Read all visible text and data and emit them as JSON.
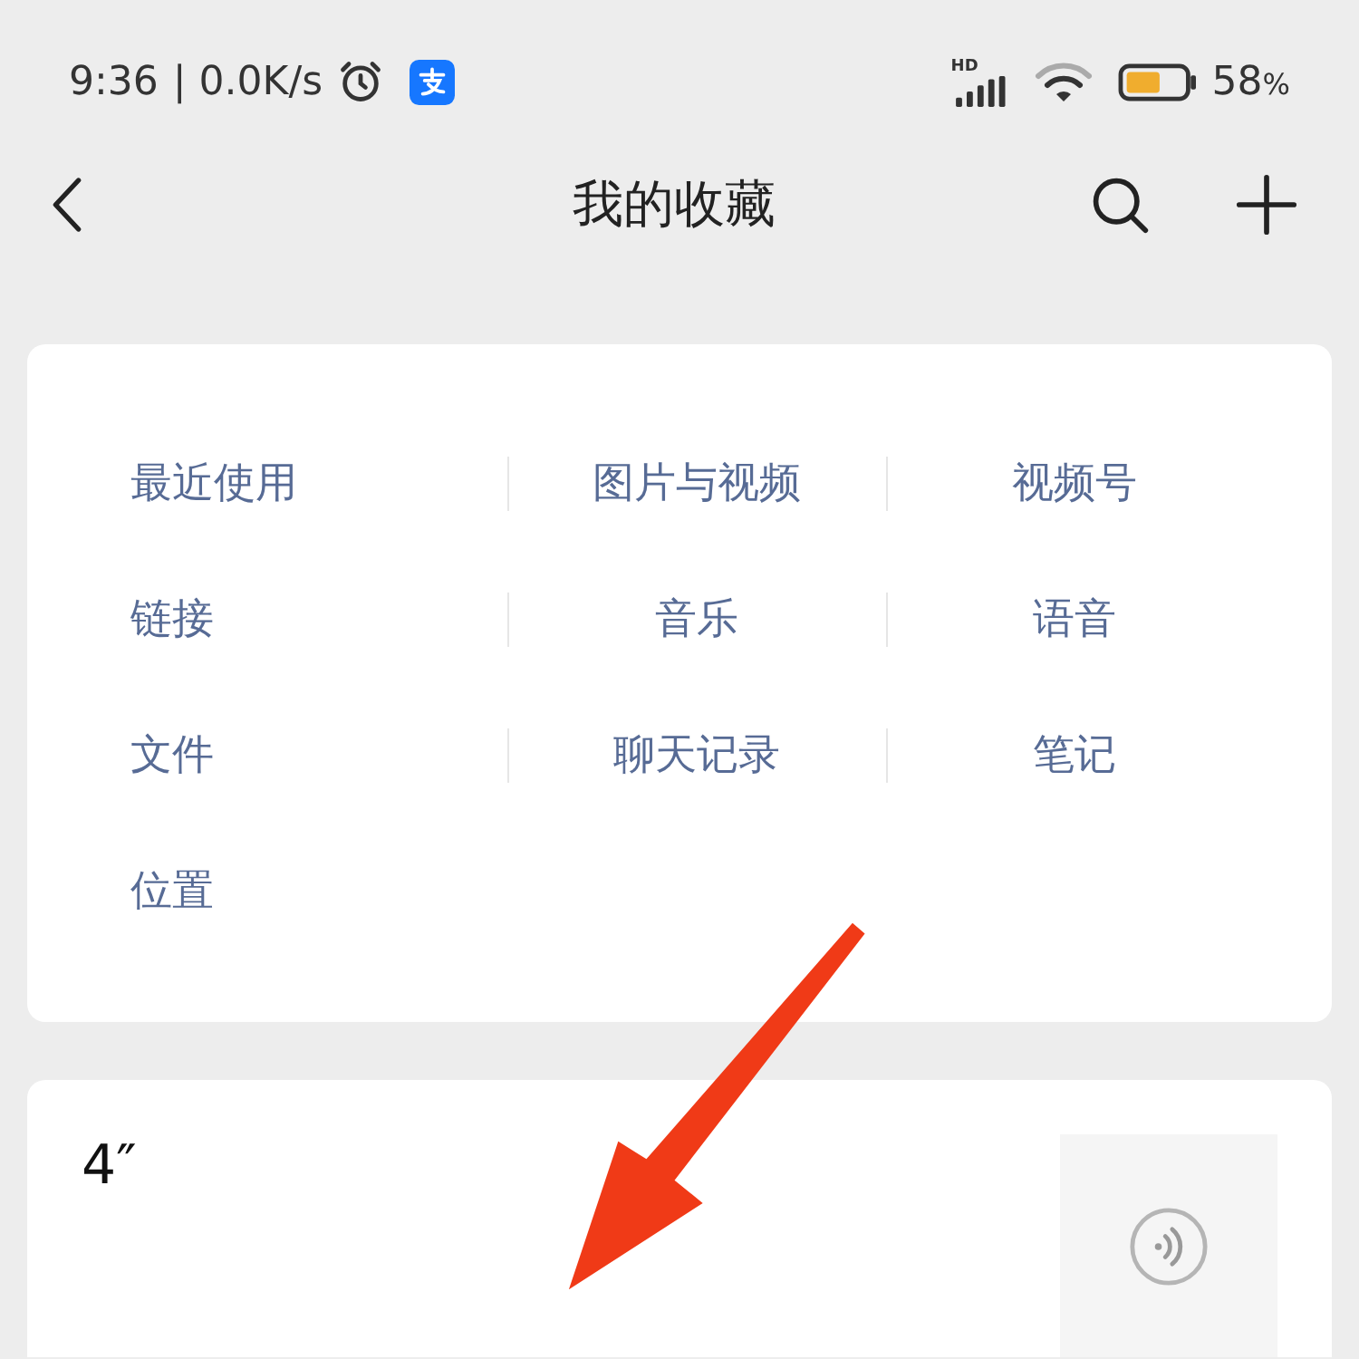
{
  "status_bar": {
    "time": "9:36",
    "speed": "| 0.0K/s",
    "network_label": "HD",
    "battery": "58",
    "battery_unit": "%"
  },
  "header": {
    "title": "我的收藏"
  },
  "categories": [
    {
      "label": "最近使用"
    },
    {
      "label": "图片与视频"
    },
    {
      "label": "视频号"
    },
    {
      "label": "链接"
    },
    {
      "label": "音乐"
    },
    {
      "label": "语音"
    },
    {
      "label": "文件"
    },
    {
      "label": "聊天记录"
    },
    {
      "label": "笔记"
    },
    {
      "label": "位置"
    }
  ],
  "favorites": [
    {
      "kind": "voice",
      "duration": "4″"
    }
  ],
  "annotations": [
    {
      "kind": "arrow"
    }
  ]
}
